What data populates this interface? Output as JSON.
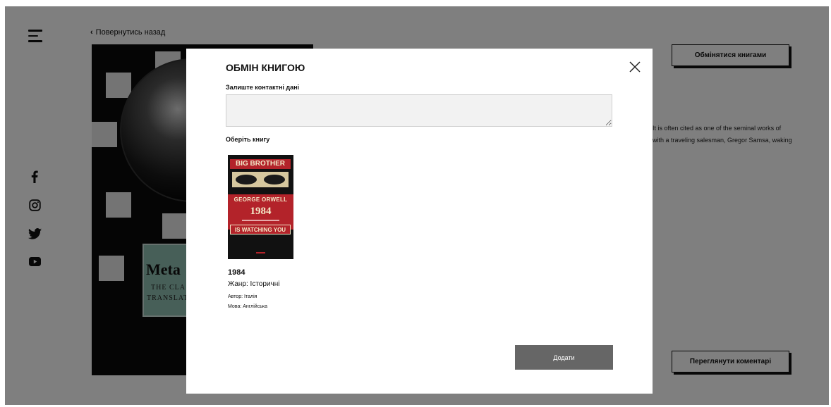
{
  "nav": {
    "back_label": "Повернутись назад",
    "menu_icon": "menu-icon"
  },
  "cover_art": {
    "title_big": "Meta",
    "line1": "THE CLA",
    "line2": "TRANSLAT"
  },
  "social": [
    "facebook-icon",
    "instagram-icon",
    "twitter-icon",
    "youtube-icon"
  ],
  "actions": {
    "exchange_label": "Обмінятися книгами",
    "comments_label": "Переглянути коментарі"
  },
  "description": {
    "line1": "It is often cited as one of the seminal works of",
    "line2": "with a traveling salesman, Gregor Samsa, waking"
  },
  "modal": {
    "title": "ОБМІН КНИГОЮ",
    "contact_label": "Залиште контактні дані",
    "contact_value": "",
    "choose_label": "Оберіть книгу",
    "add_label": "Додати",
    "close_icon": "close-icon"
  },
  "book": {
    "cover_top": "BIG BROTHER",
    "cover_author": "GEORGE ORWELL",
    "cover_year": "1984",
    "cover_bottom": "IS WATCHING YOU",
    "title": "1984",
    "genre": "Жанр: Історичні",
    "author": "Автор: Італія",
    "language": "Мова: Англійська"
  },
  "colors": {
    "overlay": "#000000",
    "add_button": "#666666",
    "cover_red": "#b3232a",
    "cover_teal": "#8fbfb0"
  }
}
